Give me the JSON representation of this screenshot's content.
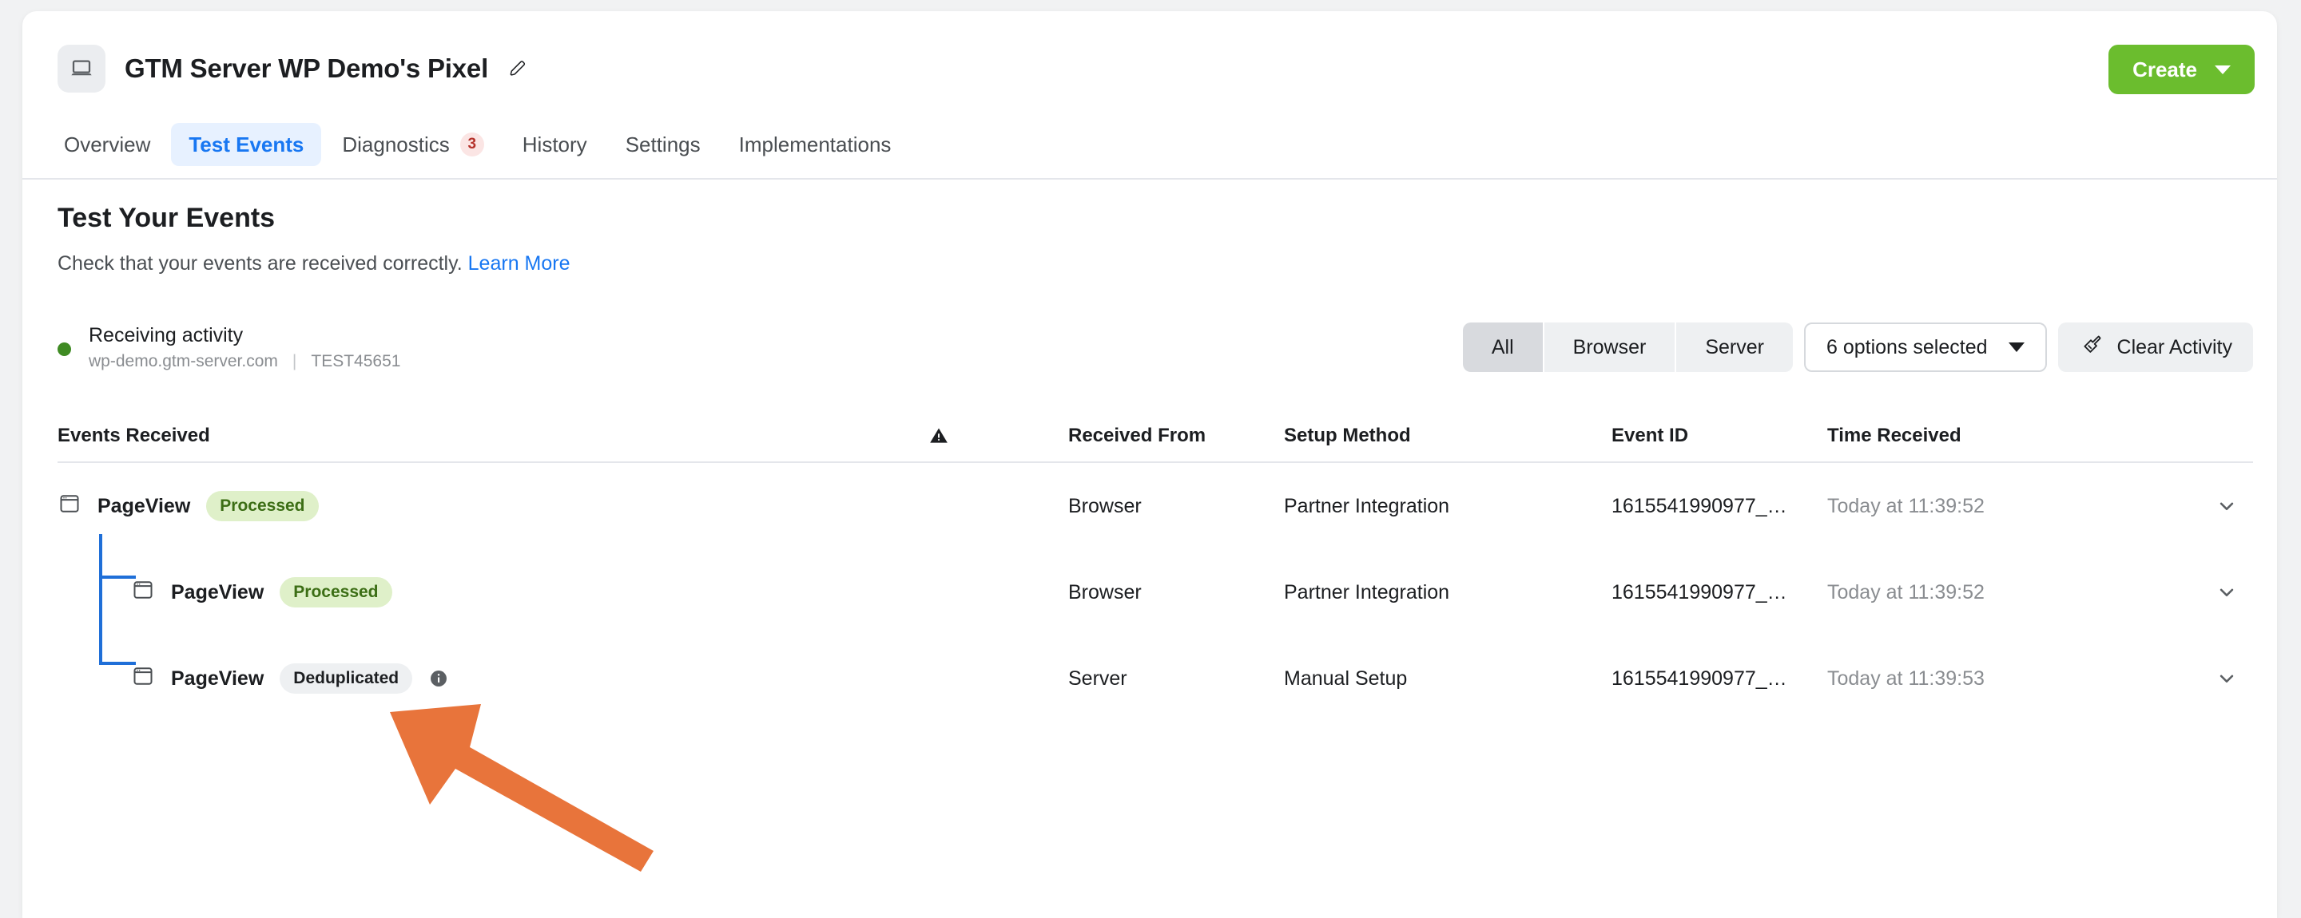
{
  "header": {
    "app_icon": "laptop-icon",
    "title": "GTM Server WP Demo's Pixel",
    "edit_icon": "pencil-icon",
    "create_label": "Create"
  },
  "tabs": [
    {
      "label": "Overview",
      "active": false,
      "badge": null
    },
    {
      "label": "Test Events",
      "active": true,
      "badge": null
    },
    {
      "label": "Diagnostics",
      "active": false,
      "badge": "3"
    },
    {
      "label": "History",
      "active": false,
      "badge": null
    },
    {
      "label": "Settings",
      "active": false,
      "badge": null
    },
    {
      "label": "Implementations",
      "active": false,
      "badge": null
    }
  ],
  "section": {
    "title": "Test Your Events",
    "subtitle": "Check that your events are received correctly.",
    "learn_more": "Learn More"
  },
  "activity": {
    "status_label": "Receiving activity",
    "domain": "wp-demo.gtm-server.com",
    "separator": "|",
    "test_code": "TEST45651",
    "status_color": "#3f8b23"
  },
  "filters": {
    "segments": [
      {
        "label": "All",
        "active": true
      },
      {
        "label": "Browser",
        "active": false
      },
      {
        "label": "Server",
        "active": false
      }
    ],
    "select_value": "6 options selected",
    "clear_label": "Clear Activity",
    "clear_icon": "broom-icon"
  },
  "table": {
    "columns": {
      "events": "Events Received",
      "warning_icon": "warning-triangle-icon",
      "received_from": "Received From",
      "setup_method": "Setup Method",
      "event_id": "Event ID",
      "time_received": "Time Received"
    },
    "rows": [
      {
        "event_name": "PageView",
        "badge": "Processed",
        "badge_type": "processed",
        "received_from": "Browser",
        "setup_method": "Partner Integration",
        "event_id": "1615541990977_…",
        "time_received": "Today at 11:39:52",
        "indent": 0,
        "tree": "none",
        "info_icon": false
      },
      {
        "event_name": "PageView",
        "badge": "Processed",
        "badge_type": "processed",
        "received_from": "Browser",
        "setup_method": "Partner Integration",
        "event_id": "1615541990977_…",
        "time_received": "Today at 11:39:52",
        "indent": 1,
        "tree": "middle",
        "info_icon": false
      },
      {
        "event_name": "PageView",
        "badge": "Deduplicated",
        "badge_type": "deduplicated",
        "received_from": "Server",
        "setup_method": "Manual Setup",
        "event_id": "1615541990977_…",
        "time_received": "Today at 11:39:53",
        "indent": 1,
        "tree": "last",
        "info_icon": true
      }
    ],
    "expand_icon": "chevron-down-icon",
    "tree_line_color": "#1f6fd8"
  },
  "annotation": {
    "shape": "arrow-pointing-up-left",
    "color": "#e8743b",
    "target": "Deduplicated"
  },
  "colors": {
    "accent_blue": "#1877f2",
    "create_green": "#6bbd2e",
    "badge_green_bg": "#dff0c9",
    "badge_green_text": "#3c6e15",
    "page_bg": "#f1f2f3"
  }
}
